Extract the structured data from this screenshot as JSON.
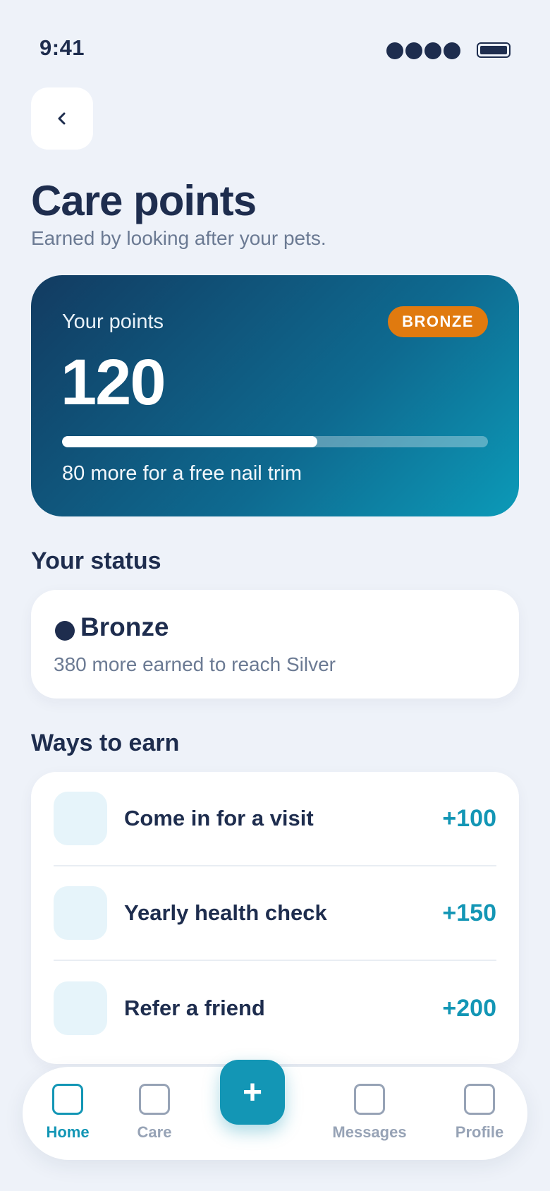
{
  "status_bar": {
    "time": "9:41",
    "signal_icon": "signal-dots-icon",
    "battery_icon": "battery-icon"
  },
  "header": {
    "back_icon": "chevron-left-icon",
    "title": "Care points",
    "subtitle": "Earned by looking after your pets."
  },
  "points_card": {
    "label": "Your points",
    "tier_badge": "BRONZE",
    "points": "120",
    "progress_fraction": 0.6,
    "note": "80 more for a free nail trim",
    "tier_color": "#E07A0F"
  },
  "status_section": {
    "title": "Your status",
    "tier_name": "Bronze",
    "note": "380 more earned to reach Silver"
  },
  "earn_section": {
    "title": "Ways to earn",
    "items": [
      {
        "label": "Come in for a visit",
        "points": "+100"
      },
      {
        "label": "Yearly health check",
        "points": "+150"
      },
      {
        "label": "Refer a friend",
        "points": "+200"
      }
    ]
  },
  "bottom_nav": {
    "items": [
      {
        "label": "Home",
        "icon": "home-icon",
        "active": true
      },
      {
        "label": "Care",
        "icon": "care-icon",
        "active": false
      },
      {
        "label": "Messages",
        "icon": "messages-icon",
        "active": false
      },
      {
        "label": "Profile",
        "icon": "profile-icon",
        "active": false
      }
    ],
    "fab_label": "+"
  },
  "colors": {
    "accent": "#1396B5",
    "background": "#EEF2F9",
    "text": "#1E2D4E",
    "muted": "#6B7A93"
  }
}
